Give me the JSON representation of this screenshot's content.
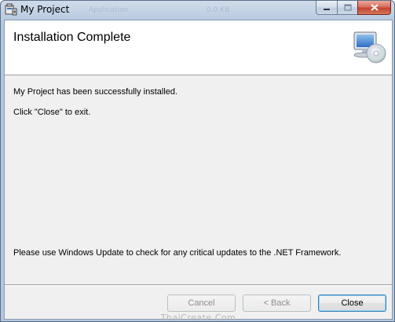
{
  "window": {
    "title": "My Project",
    "ghost_titles": [
      "Application",
      "0.0 KB"
    ]
  },
  "banner": {
    "title": "Installation Complete",
    "icon": "computer-cd-icon"
  },
  "content": {
    "line1": "My Project has been successfully installed.",
    "line2": "Click \"Close\" to exit.",
    "note": "Please use Windows Update to check for any critical updates to the .NET Framework."
  },
  "buttons": {
    "cancel": "Cancel",
    "back": "< Back",
    "close": "Close"
  },
  "watermark": "ThaiCreate.Com",
  "colors": {
    "close_button_red": "#c4432f",
    "dialog_background": "#f0f0f0",
    "title_bar": "#bccde2"
  }
}
